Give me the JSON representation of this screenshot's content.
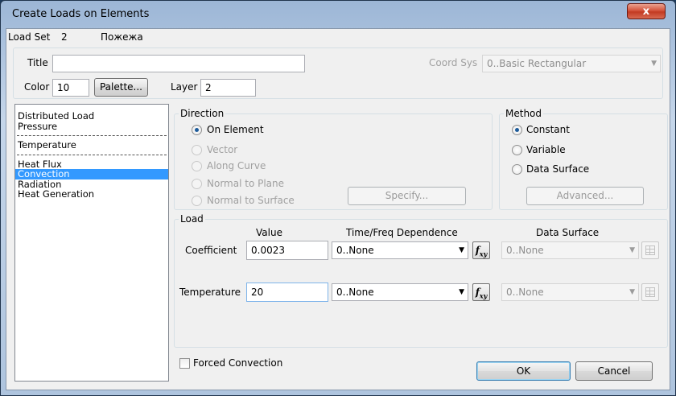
{
  "window": {
    "title": "Create Loads on Elements",
    "close_label": "x"
  },
  "header": {
    "load_set_label": "Load Set",
    "load_set_value": "2",
    "load_set_name": "Пожежа"
  },
  "props": {
    "title_label": "Title",
    "title_value": "",
    "color_label": "Color",
    "color_value": "10",
    "palette_label": "Palette...",
    "layer_label": "Layer",
    "layer_value": "2",
    "coord_sys_label": "Coord Sys",
    "coord_sys_value": "0..Basic Rectangular"
  },
  "load_types": {
    "group1": [
      "Distributed Load",
      "Pressure"
    ],
    "group2": [
      "Temperature"
    ],
    "group3": [
      "Heat Flux",
      "Convection",
      "Radiation",
      "Heat Generation"
    ],
    "selected": "Convection"
  },
  "direction": {
    "title": "Direction",
    "options": [
      "On Element",
      "Vector",
      "Along Curve",
      "Normal to Plane",
      "Normal to Surface"
    ],
    "selected": "On Element",
    "specify_label": "Specify..."
  },
  "method": {
    "title": "Method",
    "options": [
      "Constant",
      "Variable",
      "Data Surface"
    ],
    "selected": "Constant",
    "advanced_label": "Advanced..."
  },
  "load": {
    "title": "Load",
    "col_value": "Value",
    "col_time": "Time/Freq Dependence",
    "col_surface": "Data Surface",
    "rows": [
      {
        "label": "Coefficient",
        "value": "0.0023",
        "time": "0..None",
        "surface": "0..None"
      },
      {
        "label": "Temperature",
        "value": "20",
        "time": "0..None",
        "surface": "0..None"
      }
    ],
    "fxy_label": "f",
    "fxy_sub": "xy"
  },
  "footer": {
    "forced_convection_label": "Forced Convection",
    "ok_label": "OK",
    "cancel_label": "Cancel"
  },
  "colors": {
    "selection": "#3399ff",
    "window_frame": "#9cb6d6",
    "client_bg": "#f0f0f0"
  }
}
